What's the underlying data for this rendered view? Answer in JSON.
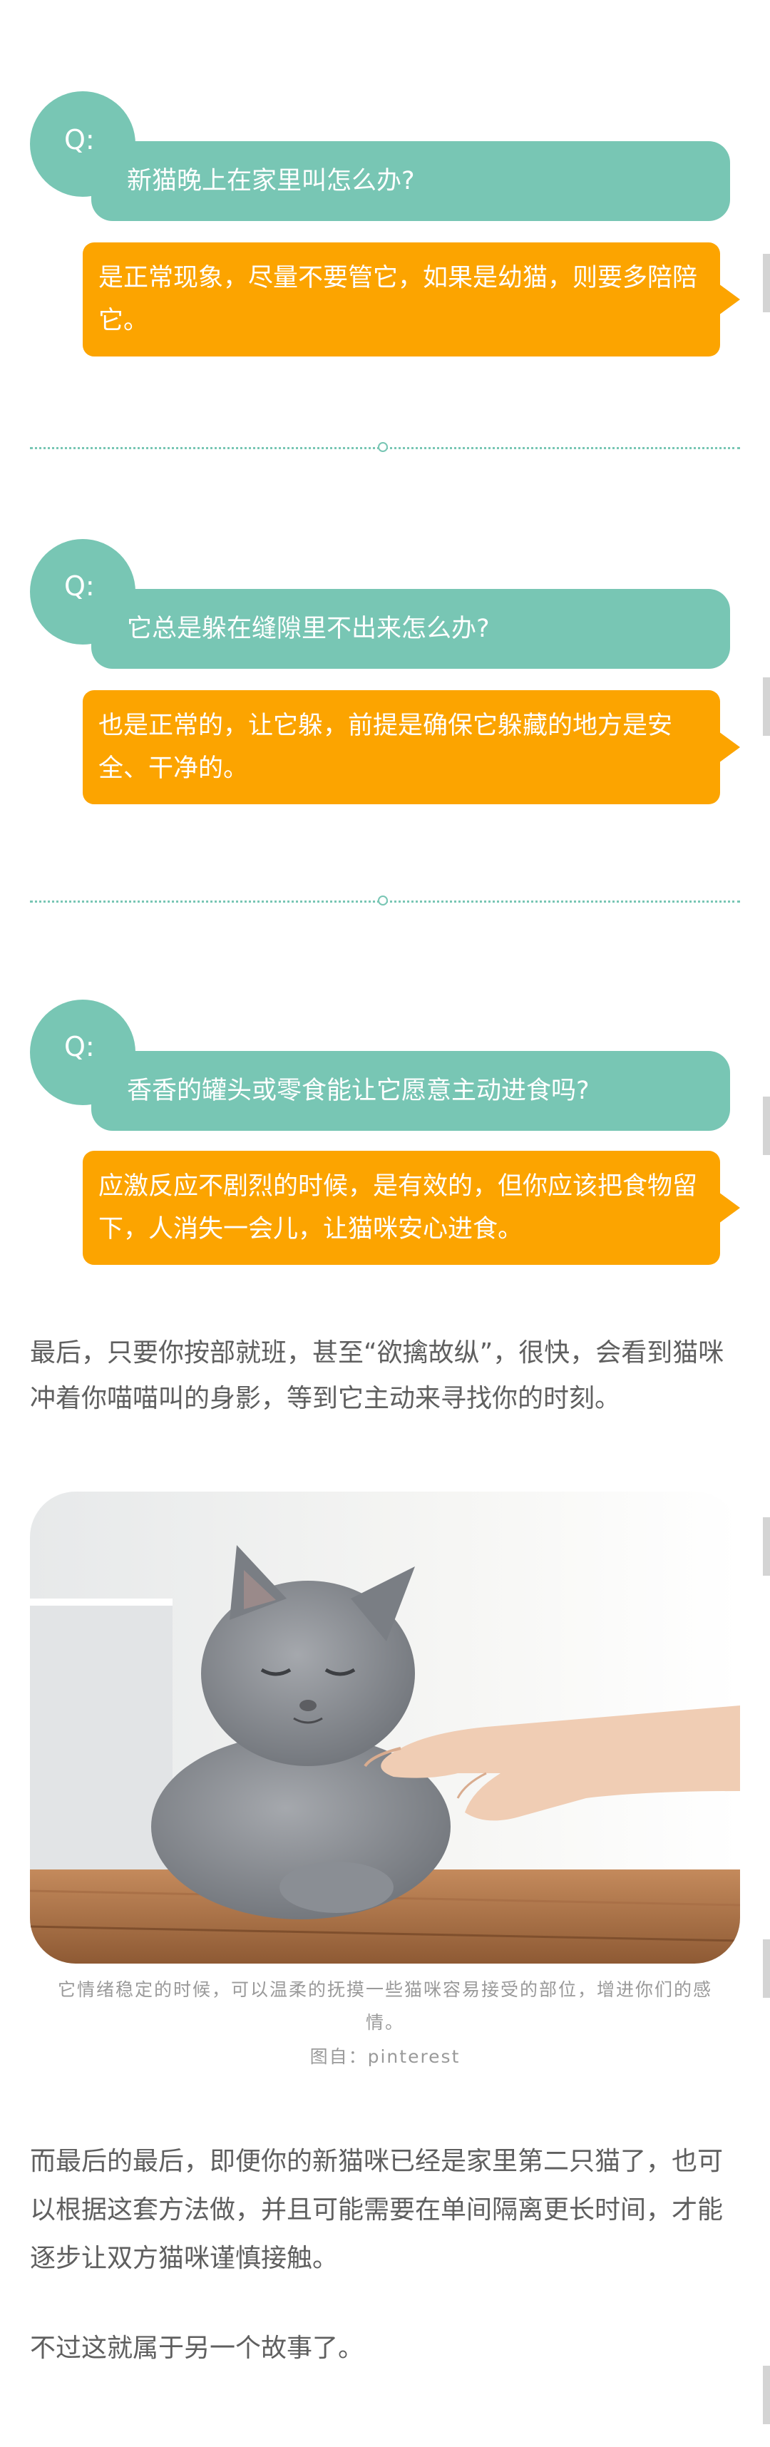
{
  "qa_items": [
    {
      "q_label": "Q:",
      "question": "新猫晚上在家里叫怎么办?",
      "answer": "是正常现象，尽量不要管它，如果是幼猫，则要多陪陪它。"
    },
    {
      "q_label": "Q:",
      "question": "它总是躲在缝隙里不出来怎么办?",
      "answer": "也是正常的，让它躲，前提是确保它躲藏的地方是安全、干净的。"
    },
    {
      "q_label": "Q:",
      "question": "香香的罐头或零食能让它愿意主动进食吗?",
      "answer": "应激反应不剧烈的时候，是有效的，但你应该把食物留下，人消失一会儿，让猫咪安心进食。"
    }
  ],
  "paragraphs": {
    "p1": "最后，只要你按部就班，甚至“欲擒故纵”，很快，会看到猫咪冲着你喵喵叫的身影，等到它主动来寻找你的时刻。",
    "p2": "而最后的最后，即便你的新猫咪已经是家里第二只猫了，也可以根据这套方法做，并且可能需要在单间隔离更长时间，才能逐步让双方猫咪谨慎接触。",
    "p3": "不过这就属于另一个故事了。"
  },
  "photo": {
    "caption": "它情绪稳定的时候，可以温柔的抚摸一些猫咪容易接受的部位，增进你们的感情。",
    "credit": "图自：pinterest"
  },
  "colors": {
    "question_bubble": "#78c6b4",
    "answer_bubble": "#fca400",
    "text": "#5f5f5f"
  }
}
